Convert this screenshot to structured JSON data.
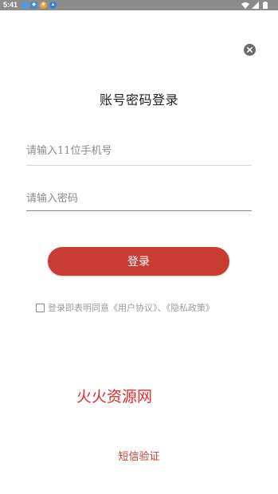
{
  "status_bar": {
    "time": "5:41",
    "icons": [
      "notification-dot-icon",
      "notification-icon",
      "notification-icon",
      "notification-icon",
      "wifi-icon",
      "signal-icon",
      "battery-icon"
    ]
  },
  "login": {
    "title": "账号密码登录",
    "phone_placeholder": "请输入11位手机号",
    "password_placeholder": "请输入密码",
    "submit_label": "登录",
    "agreement": {
      "prefix": "登录即表明同意",
      "user_agreement": "《用户协议》",
      "separator": "、",
      "privacy_policy": "《隐私政策》"
    },
    "sms_login_label": "短信验证"
  },
  "watermark": "火火资源网",
  "colors": {
    "accent": "#c83c31",
    "status_bar": "#8c8c8c",
    "watermark": "#e8272a"
  }
}
